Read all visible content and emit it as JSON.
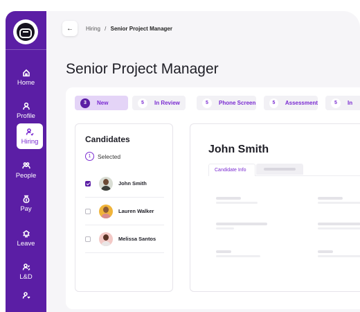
{
  "sidebar": {
    "logo_icon": "company-logo-icon",
    "items": [
      {
        "label": "Home",
        "icon": "home-icon"
      },
      {
        "label": "Profile",
        "icon": "profile-icon"
      },
      {
        "label": "Hiring",
        "icon": "hiring-icon",
        "active": true
      },
      {
        "label": "People",
        "icon": "people-icon"
      },
      {
        "label": "Pay",
        "icon": "pay-icon"
      },
      {
        "label": "Leave",
        "icon": "leave-icon"
      },
      {
        "label": "L&D",
        "icon": "learning-icon"
      }
    ],
    "accent": "#5b1ea5"
  },
  "header": {
    "back_icon": "arrow-left-icon",
    "back_glyph": "←",
    "breadcrumb_parent": "Hiring",
    "breadcrumb_separator": "/",
    "breadcrumb_current": "Senior Project Manager",
    "title": "Senior Project Manager"
  },
  "stages": [
    {
      "count": "3",
      "label": "New",
      "active": true
    },
    {
      "count": "5",
      "label": "In Review"
    },
    {
      "count": "5",
      "label": "Phone Screen"
    },
    {
      "count": "5",
      "label": "Assessment"
    },
    {
      "count": "5",
      "label": "In"
    }
  ],
  "candidates": {
    "title": "Candidates",
    "selected_count": "1",
    "selected_label": "Selected",
    "list": [
      {
        "name": "John Smith",
        "checked": true
      },
      {
        "name": "Lauren Walker",
        "checked": false
      },
      {
        "name": "Melissa Santos",
        "checked": false
      }
    ]
  },
  "detail": {
    "name": "John Smith",
    "active_tab": "Candidate Info"
  },
  "colors": {
    "primary": "#5b1ea5",
    "accent_text": "#7a2bd1",
    "active_stage_bg": "#e4d4f7",
    "background": "#f6f5f8"
  }
}
